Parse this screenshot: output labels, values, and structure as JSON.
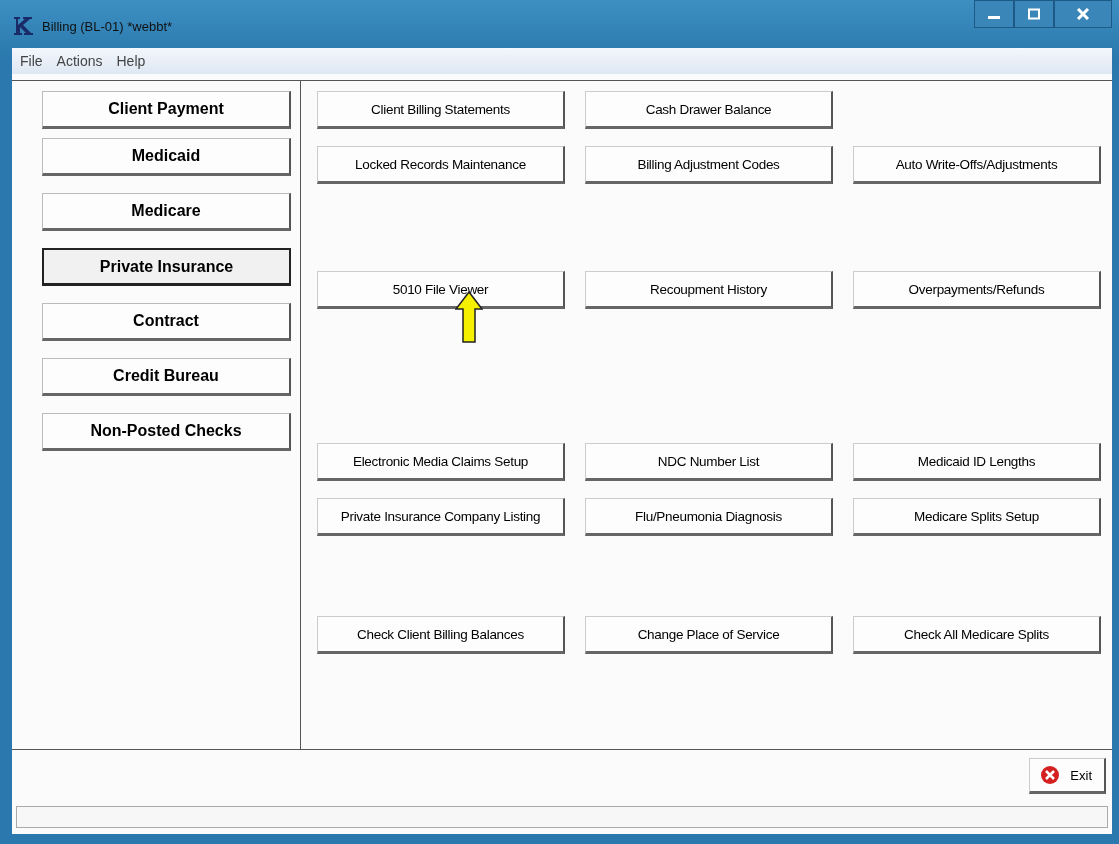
{
  "window": {
    "title": "Billing (BL-01)  *webbt*"
  },
  "menu": [
    "File",
    "Actions",
    "Help"
  ],
  "sidebar": {
    "items": [
      {
        "label": "Client Payment",
        "selected": false
      },
      {
        "label": "Medicaid",
        "selected": false
      },
      {
        "label": "Medicare",
        "selected": false
      },
      {
        "label": "Private Insurance",
        "selected": true
      },
      {
        "label": "Contract",
        "selected": false
      },
      {
        "label": "Credit Bureau",
        "selected": false
      },
      {
        "label": "Non-Posted Checks",
        "selected": false
      }
    ]
  },
  "groups": [
    [
      [
        "Client Billing Statements",
        "Cash Drawer Balance"
      ],
      [
        "Locked Records Maintenance",
        "Billing Adjustment Codes",
        "Auto Write-Offs/Adjustments"
      ]
    ],
    [
      [
        "5010 File Viewer",
        "Recoupment History",
        "Overpayments/Refunds"
      ]
    ],
    [
      [
        "Electronic Media Claims Setup",
        "NDC Number List",
        "Medicaid ID Lengths"
      ],
      [
        "Private Insurance Company Listing",
        "Flu/Pneumonia Diagnosis",
        "Medicare Splits Setup"
      ]
    ],
    [
      [
        "Check Client Billing Balances",
        "Change Place of Service",
        "Check All Medicare Splits"
      ]
    ]
  ],
  "exit_button": "Exit"
}
